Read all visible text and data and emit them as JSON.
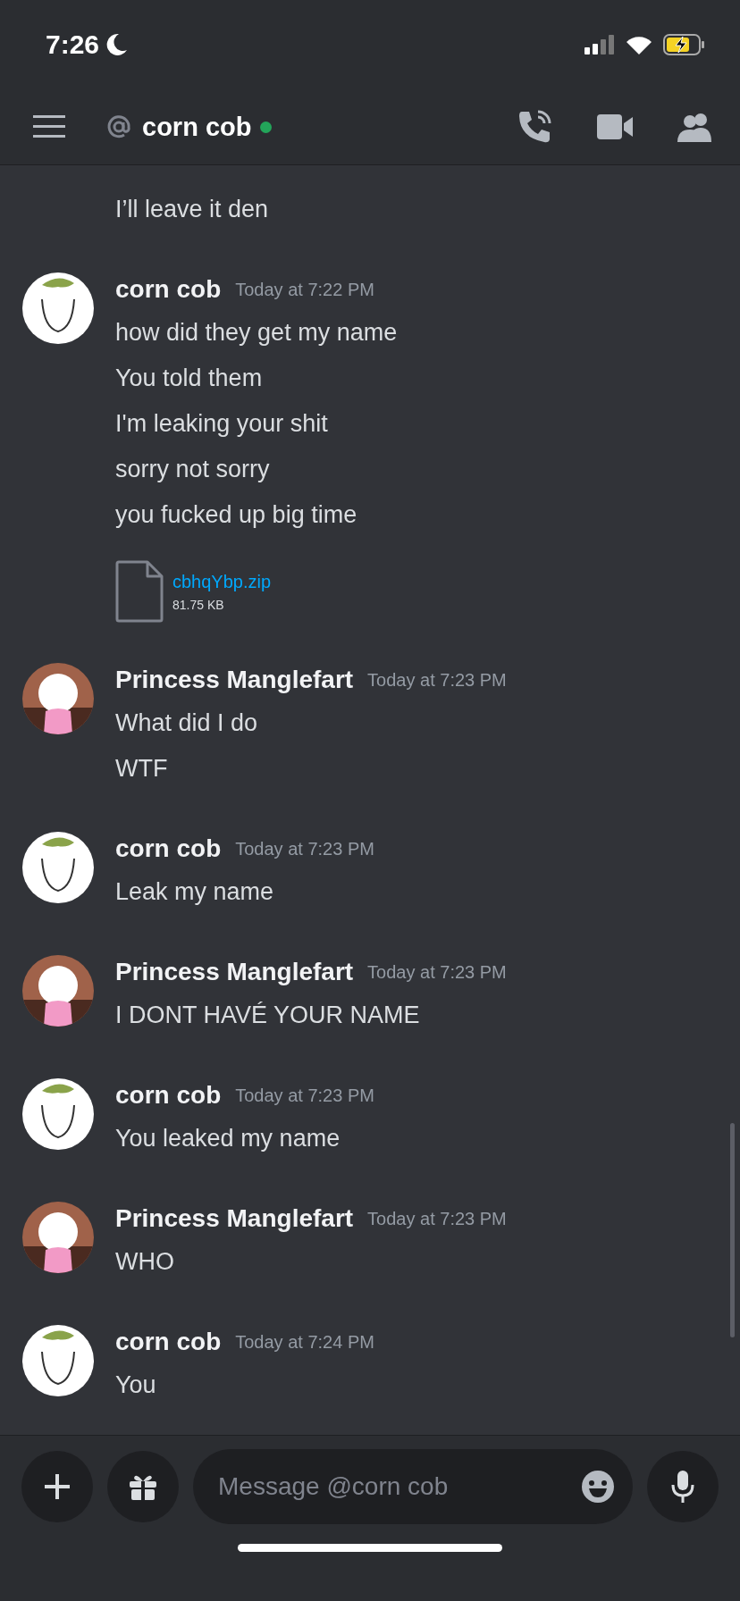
{
  "status_bar": {
    "time": "7:26"
  },
  "header": {
    "title": "corn cob",
    "online": true
  },
  "messages": [
    {
      "kind": "continuation",
      "lines": [
        "I’ll leave it den"
      ]
    },
    {
      "kind": "group",
      "avatar": {
        "kind": "cob"
      },
      "author": "corn cob",
      "timestamp": "Today at 7:22 PM",
      "lines": [
        "how did they get my name",
        "You told them",
        "I'm leaking your shit",
        "sorry not sorry",
        "you fucked up big time"
      ],
      "attachment": {
        "name": "cbhqYbp.zip",
        "size": "81.75 KB"
      }
    },
    {
      "kind": "group",
      "avatar": {
        "kind": "princess"
      },
      "author": "Princess Manglefart",
      "timestamp": "Today at 7:23 PM",
      "lines": [
        "What did I do",
        "WTF"
      ]
    },
    {
      "kind": "group",
      "avatar": {
        "kind": "cob"
      },
      "author": "corn cob",
      "timestamp": "Today at 7:23 PM",
      "lines": [
        "Leak my name"
      ]
    },
    {
      "kind": "group",
      "avatar": {
        "kind": "princess"
      },
      "author": "Princess Manglefart",
      "timestamp": "Today at 7:23 PM",
      "lines": [
        "I DONT HAVÉ YOUR NAME"
      ]
    },
    {
      "kind": "group",
      "avatar": {
        "kind": "cob"
      },
      "author": "corn cob",
      "timestamp": "Today at 7:23 PM",
      "lines": [
        "You leaked my name"
      ]
    },
    {
      "kind": "group",
      "avatar": {
        "kind": "princess"
      },
      "author": "Princess Manglefart",
      "timestamp": "Today at 7:23 PM",
      "lines": [
        "WHO"
      ]
    },
    {
      "kind": "group",
      "avatar": {
        "kind": "cob"
      },
      "author": "corn cob",
      "timestamp": "Today at 7:24 PM",
      "lines": [
        "You"
      ]
    }
  ],
  "composer": {
    "placeholder": "Message @corn cob"
  }
}
